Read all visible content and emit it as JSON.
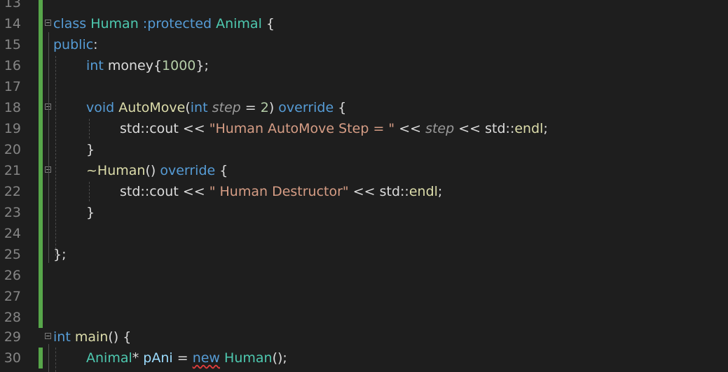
{
  "editor": {
    "line_numbers": [
      "13",
      "14",
      "15",
      "16",
      "17",
      "18",
      "19",
      "20",
      "21",
      "22",
      "23",
      "24",
      "25",
      "26",
      "27",
      "28",
      "29",
      "30"
    ],
    "l14": {
      "kw_class": "class",
      "cls": "Human",
      "colon_prot": ":protected",
      "base": "Animal",
      "brace": "{"
    },
    "l15": {
      "kw_public": "public",
      "colon": ":"
    },
    "l16": {
      "kw_int": "int",
      "member": "money",
      "init_open": "{",
      "value": "1000",
      "init_close": "};"
    },
    "l18": {
      "kw_void": "void",
      "fn": "AutoMove",
      "paren": "(",
      "kw_int": "int",
      "param": "step",
      "eq": "=",
      "num": "2",
      "paren_close": ")",
      "kw_override": "override",
      "brace": "{"
    },
    "l19": {
      "ns": "std",
      "sep": "::",
      "cout": "cout",
      "op": "<<",
      "str": "\"Human AutoMove Step = \"",
      "op2": "<<",
      "var": "step",
      "op3": "<<",
      "ns2": "std",
      "sep2": "::",
      "endl": "endl",
      "semi": ";"
    },
    "l20": {
      "brace": "}"
    },
    "l21": {
      "dtor": "~Human",
      "parens": "()",
      "kw_override": "override",
      "brace": "{"
    },
    "l22": {
      "ns": "std",
      "sep": "::",
      "cout": "cout",
      "op": "<<",
      "str": "\" Human Destructor\"",
      "op2": "<<",
      "ns2": "std",
      "sep2": "::",
      "endl": "endl",
      "semi": ";"
    },
    "l23": {
      "brace": "}"
    },
    "l25": {
      "close": "};"
    },
    "l29": {
      "kw_int": "int",
      "fn": "main",
      "parens": "()",
      "brace": "{"
    },
    "l30": {
      "type": "Animal",
      "star": "*",
      "var": "pAni",
      "eq": "=",
      "kw_new": "new",
      "cls": "Human",
      "call": "();"
    }
  },
  "colors": {
    "background": "#1e1e1e",
    "keyword": "#569cd6",
    "type": "#4ec9b0",
    "function": "#dcdcaa",
    "string": "#d69d85",
    "number": "#b5cea8",
    "change_bar": "#57a64a"
  }
}
